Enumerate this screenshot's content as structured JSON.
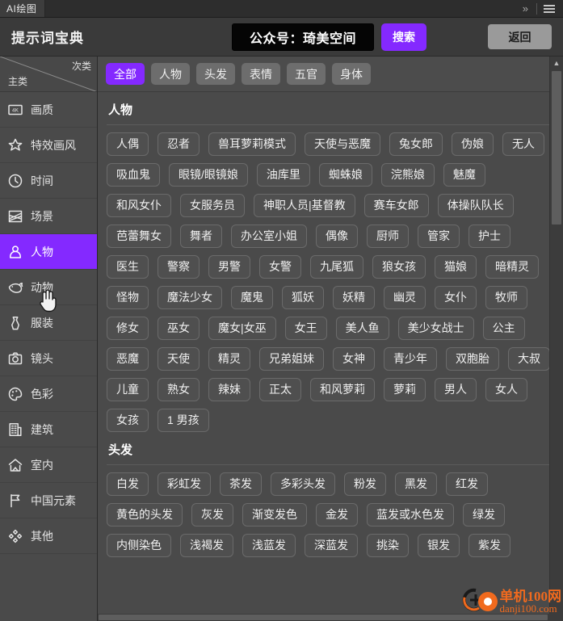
{
  "titlebar": {
    "tab_label": "AI绘图",
    "expand_icon": "chevron-double-right-icon",
    "menu_icon": "hamburger-menu-icon"
  },
  "header": {
    "title": "提示词宝典",
    "search_value": "公众号：琦美空间",
    "search_placeholder": "公众号：琦美空间",
    "search_button": "搜索",
    "back_button": "返回",
    "accent_color": "#8429ff",
    "back_button_color": "#9a9a9a"
  },
  "sidebar": {
    "head_sub": "次类",
    "head_main": "主类",
    "items": [
      {
        "label": "画质",
        "icon": "resolution-4k-icon",
        "active": false
      },
      {
        "label": "特效画风",
        "icon": "sparkle-star-icon",
        "active": false
      },
      {
        "label": "时间",
        "icon": "clock-icon",
        "active": false
      },
      {
        "label": "场景",
        "icon": "landscape-icon",
        "active": false
      },
      {
        "label": "人物",
        "icon": "person-icon",
        "active": true
      },
      {
        "label": "动物",
        "icon": "whale-icon",
        "active": false
      },
      {
        "label": "服装",
        "icon": "dress-icon",
        "active": false
      },
      {
        "label": "镜头",
        "icon": "camera-icon",
        "active": false
      },
      {
        "label": "色彩",
        "icon": "palette-icon",
        "active": false
      },
      {
        "label": "建筑",
        "icon": "building-icon",
        "active": false
      },
      {
        "label": "室内",
        "icon": "house-icon",
        "active": false
      },
      {
        "label": "中国元素",
        "icon": "flag-icon",
        "active": false
      },
      {
        "label": "其他",
        "icon": "diamonds-icon",
        "active": false
      }
    ]
  },
  "filters": [
    {
      "label": "全部",
      "active": true
    },
    {
      "label": "人物",
      "active": false
    },
    {
      "label": "头发",
      "active": false
    },
    {
      "label": "表情",
      "active": false
    },
    {
      "label": "五官",
      "active": false
    },
    {
      "label": "身体",
      "active": false
    }
  ],
  "sections": [
    {
      "title": "人物",
      "tags": [
        "人偶",
        "忍者",
        "兽耳萝莉模式",
        "天使与恶魔",
        "兔女郎",
        "伪娘",
        "无人",
        "吸血鬼",
        "眼镜/眼镜娘",
        "油库里",
        "蜘蛛娘",
        "浣熊娘",
        "魅魔",
        "和风女仆",
        "女服务员",
        "神职人员|基督教",
        "赛车女郎",
        "体操队队长",
        "芭蕾舞女",
        "舞者",
        "办公室小姐",
        "偶像",
        "厨师",
        "管家",
        "护士",
        "医生",
        "警察",
        "男警",
        "女警",
        "九尾狐",
        "狼女孩",
        "猫娘",
        "暗精灵",
        "怪物",
        "魔法少女",
        "魔鬼",
        "狐妖",
        "妖精",
        "幽灵",
        "女仆",
        "牧师",
        "修女",
        "巫女",
        "魔女|女巫",
        "女王",
        "美人鱼",
        "美少女战士",
        "公主",
        "恶魔",
        "天使",
        "精灵",
        "兄弟姐妹",
        "女神",
        "青少年",
        "双胞胎",
        "大叔",
        "儿童",
        "熟女",
        "辣妹",
        "正太",
        "和风萝莉",
        "萝莉",
        "男人",
        "女人",
        "女孩",
        "1 男孩"
      ]
    },
    {
      "title": "头发",
      "tags": [
        "白发",
        "彩虹发",
        "茶发",
        "多彩头发",
        "粉发",
        "黑发",
        "红发",
        "黄色的头发",
        "灰发",
        "渐变发色",
        "金发",
        "蓝发或水色发",
        "绿发",
        "内侧染色",
        "浅褐发",
        "浅蓝发",
        "深蓝发",
        "挑染",
        "银发",
        "紫发"
      ]
    }
  ],
  "scrollbars": {
    "vertical_arrow_up": "chevron-up-icon"
  },
  "watermark": {
    "line1": "单机100网",
    "line2": "danji100.com",
    "color": "#f06a1e"
  }
}
